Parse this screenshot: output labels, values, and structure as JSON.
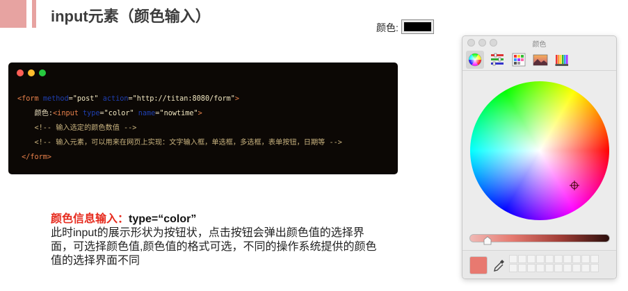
{
  "slide": {
    "title": "input元素（颜色输入）",
    "colors": {
      "accent": "#e7a3a1",
      "code_bg": "#0c0805",
      "emphasis": "#e62b1e"
    }
  },
  "demo": {
    "label": "颜色:",
    "swatch_color": "#000000"
  },
  "code": {
    "lines": [
      [
        {
          "t": "tag",
          "v": "<form "
        },
        {
          "t": "attr",
          "v": "method"
        },
        {
          "t": "plain",
          "v": "="
        },
        {
          "t": "str",
          "v": "\"post\""
        },
        {
          "t": "plain",
          "v": " "
        },
        {
          "t": "attr",
          "v": "action"
        },
        {
          "t": "plain",
          "v": "="
        },
        {
          "t": "str",
          "v": "\"http://titan:8080/form\""
        },
        {
          "t": "tag",
          "v": ">"
        }
      ],
      [
        {
          "t": "plain",
          "v": "    颜色:"
        },
        {
          "t": "tag",
          "v": "<input "
        },
        {
          "t": "attr",
          "v": "type"
        },
        {
          "t": "plain",
          "v": "="
        },
        {
          "t": "str",
          "v": "\"color\""
        },
        {
          "t": "plain",
          "v": " "
        },
        {
          "t": "attr",
          "v": "name"
        },
        {
          "t": "plain",
          "v": "="
        },
        {
          "t": "str",
          "v": "\"nowtime\""
        },
        {
          "t": "tag",
          "v": ">"
        }
      ],
      [
        {
          "t": "cm",
          "v": "    <!-- 输入选定的颜色数值 -->"
        }
      ],
      [
        {
          "t": "cm",
          "v": "    <!-- 输入元素，可以用来在网页上实现：文字输入框，单选框，多选框，表单按钮，日期等 -->"
        }
      ],
      [
        {
          "t": "tag",
          "v": " </form>"
        }
      ]
    ]
  },
  "description": {
    "head_label": "颜色信息输入：",
    "head_value": "type=“color”",
    "body": "此时input的展示形状为按钮状，点击按钮会弹出颜色值的选择界面，可选择颜色值,颜色值的格式可选，不同的操作系统提供的颜色值的选择界面不同"
  },
  "picker": {
    "title": "颜色",
    "toolbar_icons": [
      "color-wheel-icon",
      "sliders-icon",
      "palettes-icon",
      "image-palette-icon",
      "pencils-icon"
    ],
    "current_color": "#e87970",
    "brightness": 0.07,
    "swatch_slots": 20
  }
}
